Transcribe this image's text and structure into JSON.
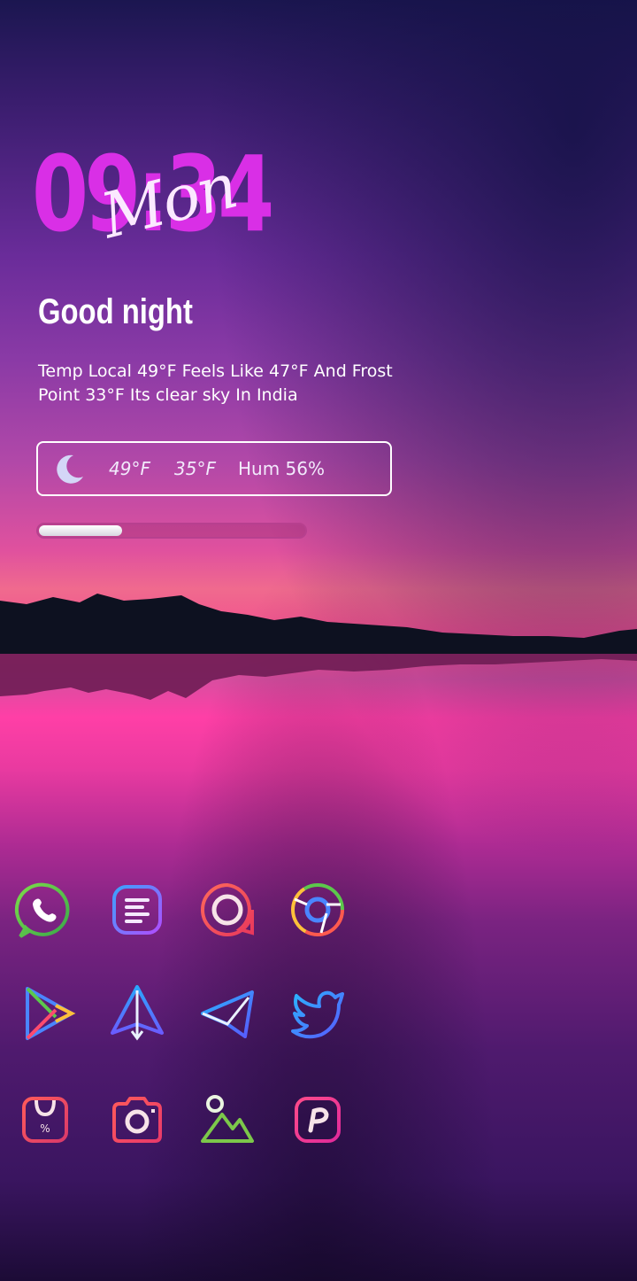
{
  "clock": {
    "time": "09:34",
    "hours": "09",
    "minutes": "34",
    "day": "Mon"
  },
  "greeting": "Good night",
  "weather": {
    "line1": "Temp Local 49°F Feels Like 47°F And Frost",
    "line2": "Point 33°F Its clear sky In India",
    "high": "49°F",
    "low": "35°F",
    "humidity": "Hum 56%",
    "icon": "moon-icon"
  },
  "progress": {
    "value_percent": 31
  },
  "apps": [
    {
      "name": "whatsapp",
      "icon": "whatsapp-icon"
    },
    {
      "name": "notes",
      "icon": "notes-icon"
    },
    {
      "name": "messages",
      "icon": "chat-bubble-icon"
    },
    {
      "name": "chrome",
      "icon": "chrome-icon"
    },
    {
      "name": "play-store",
      "icon": "play-store-icon"
    },
    {
      "name": "send",
      "icon": "paper-plane-icon"
    },
    {
      "name": "telegram",
      "icon": "telegram-icon"
    },
    {
      "name": "twitter",
      "icon": "twitter-icon"
    },
    {
      "name": "shop",
      "icon": "shopping-bag-icon"
    },
    {
      "name": "camera",
      "icon": "camera-icon"
    },
    {
      "name": "gallery",
      "icon": "gallery-icon"
    },
    {
      "name": "picsart",
      "icon": "picsart-icon"
    }
  ],
  "colors": {
    "clock": "#d92fe6",
    "accent_pink": "#ff3fa6",
    "sky_top": "#1b1650"
  }
}
